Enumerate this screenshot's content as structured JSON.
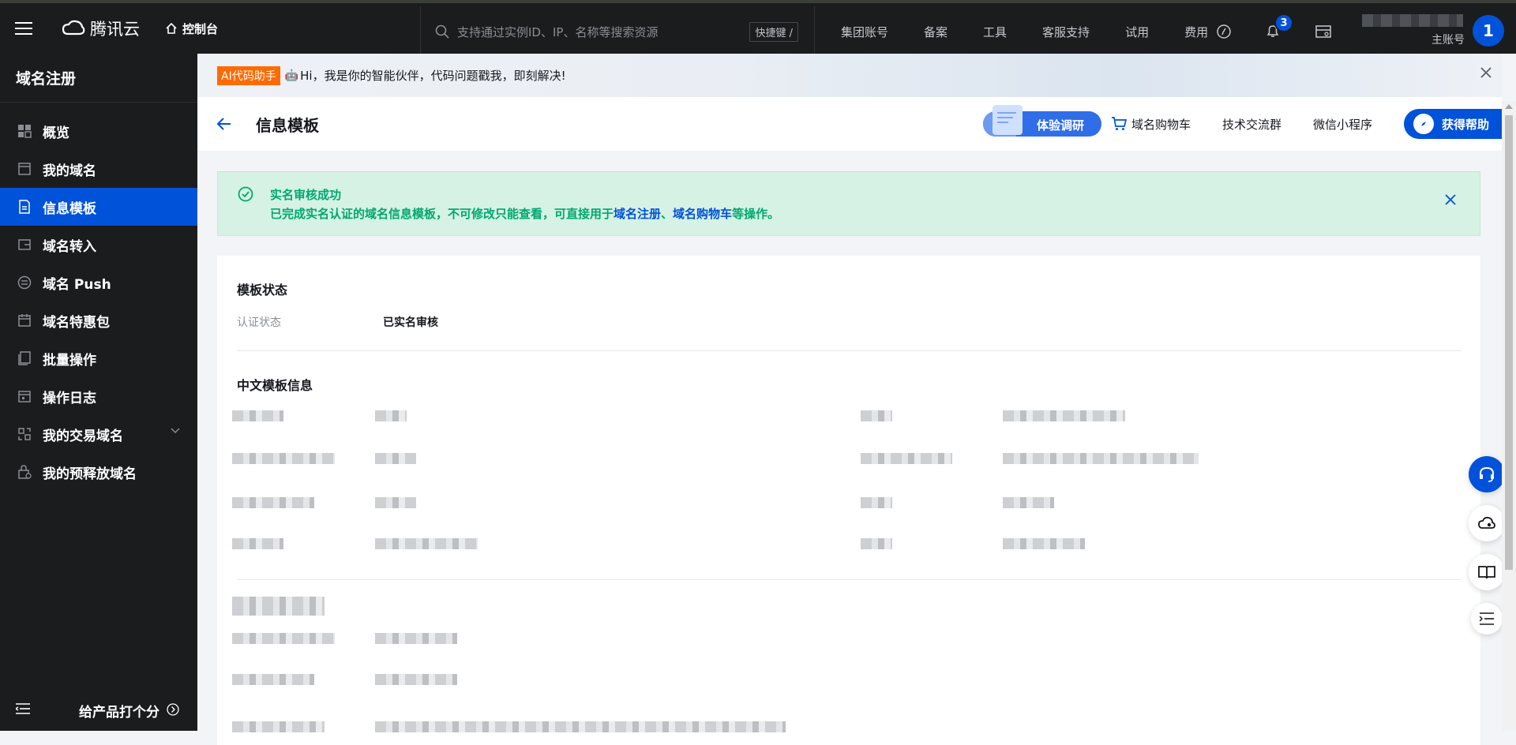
{
  "topbar": {
    "brand": "腾讯云",
    "console": "控制台",
    "search_placeholder": "支持通过实例ID、IP、名称等搜索资源",
    "shortcut_label": "快捷键 /",
    "nav": [
      "集团账号",
      "备案",
      "工具",
      "客服支持",
      "试用",
      "费用"
    ],
    "notification_count": "3",
    "account_role": "主账号",
    "avatar_initial": "1"
  },
  "sidebar": {
    "title": "域名注册",
    "items": [
      {
        "label": "概览",
        "icon": "grid-icon"
      },
      {
        "label": "我的域名",
        "icon": "domain-icon"
      },
      {
        "label": "信息模板",
        "icon": "document-icon",
        "active": true
      },
      {
        "label": "域名转入",
        "icon": "transfer-icon"
      },
      {
        "label": "域名 Push",
        "icon": "push-icon"
      },
      {
        "label": "域名特惠包",
        "icon": "calendar-icon"
      },
      {
        "label": "批量操作",
        "icon": "batch-icon"
      },
      {
        "label": "操作日志",
        "icon": "log-icon"
      },
      {
        "label": "我的交易域名",
        "icon": "trade-icon"
      },
      {
        "label": "我的预释放域名",
        "icon": "lock-icon"
      }
    ],
    "rate_label": "给产品打个分"
  },
  "ai_banner": {
    "tag": "AI代码助手",
    "text": "Hi，我是你的智能伙伴，代码问题戳我，即刻解决!"
  },
  "page_header": {
    "title": "信息模板",
    "survey_label": "体验调研",
    "cart_label": "域名购物车",
    "group_label": "技术交流群",
    "miniprogram_label": "微信小程序",
    "help_label": "获得帮助"
  },
  "alert": {
    "title": "实名审核成功",
    "text_prefix": "已完成实名认证的域名信息模板，不可修改只能查看，可直接用于",
    "link1": "域名注册",
    "separator": "、",
    "link2": "域名购物车",
    "text_suffix": "等操作。"
  },
  "template_status": {
    "section_title": "模板状态",
    "label": "认证状态",
    "value": "已实名审核"
  },
  "cn_info": {
    "section_title": "中文模板信息"
  },
  "colors": {
    "accent": "#0052d9",
    "success": "#00a870",
    "success_bg": "#d5f2e4",
    "topbar_bg": "#1b1c1e",
    "ai_tag": "#ff6a00"
  }
}
